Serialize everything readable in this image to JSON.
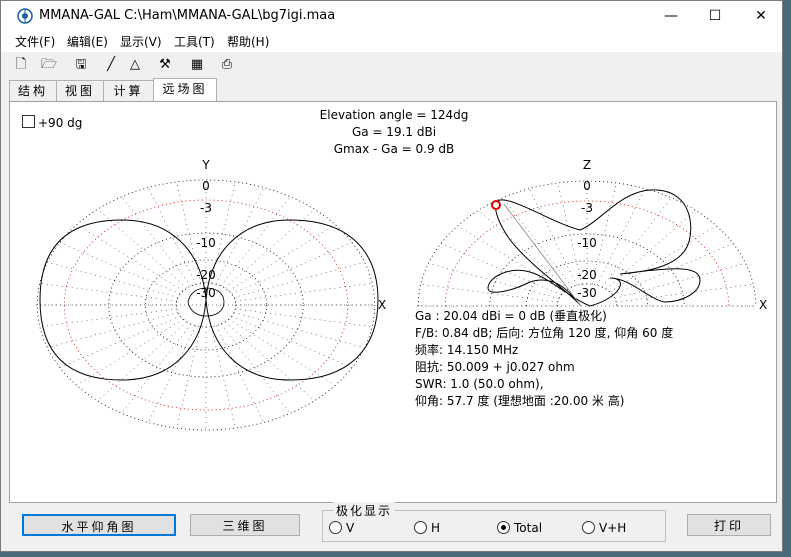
{
  "window": {
    "title": "MMANA-GAL C:\\Ham\\MMANA-GAL\\bg7igi.maa",
    "minimize": "—",
    "maximize": "☐",
    "close": "✕"
  },
  "menu": [
    {
      "label": "文件(F)"
    },
    {
      "label": "编辑(E)"
    },
    {
      "label": "显示(V)"
    },
    {
      "label": "工具(T)"
    },
    {
      "label": "帮助(H)"
    }
  ],
  "toolbar": {
    "new": "🗋",
    "open": "🗁",
    "save": "🖫",
    "line": "╱",
    "triangle": "△",
    "tools": "⚒",
    "calc": "▦",
    "export": "⎙"
  },
  "tabs": [
    {
      "label": "结构"
    },
    {
      "label": "视图"
    },
    {
      "label": "计算"
    },
    {
      "label": "远场图"
    }
  ],
  "panel": {
    "checkbox_label": "+90 dg",
    "elevation_angle": "Elevation angle = 124dg",
    "ga": "Ga = 19.1 dBi",
    "gmax": "Gmax - Ga = 0.9 dB",
    "left_plot": {
      "axis_y": "Y",
      "axis_x": "X",
      "rings": [
        "0",
        "-3",
        "-10",
        "-20",
        "-30"
      ]
    },
    "right_plot": {
      "axis_z": "Z",
      "axis_x": "X",
      "rings": [
        "0",
        "-3",
        "-10",
        "-20",
        "-30"
      ]
    },
    "info": [
      "Ga : 20.04 dBi = 0 dB  (垂直极化)",
      "F/B: 0.84 dB; 后向: 方位角 120 度, 仰角 60 度",
      "频率: 14.150 MHz",
      "阻抗: 50.009 + j0.027 ohm",
      "SWR: 1.0 (50.0 ohm),",
      "仰角: 57.7 度 (理想地面  :20.00 米 高)"
    ]
  },
  "bottom": {
    "btn_horizontal": "水平仰角图",
    "btn_3d": "三维图",
    "polarization_title": "极化显示",
    "radios": [
      {
        "label": "V",
        "checked": false
      },
      {
        "label": "H",
        "checked": false
      },
      {
        "label": "Total",
        "checked": true
      },
      {
        "label": "V+H",
        "checked": false
      }
    ],
    "btn_print": "打印"
  }
}
